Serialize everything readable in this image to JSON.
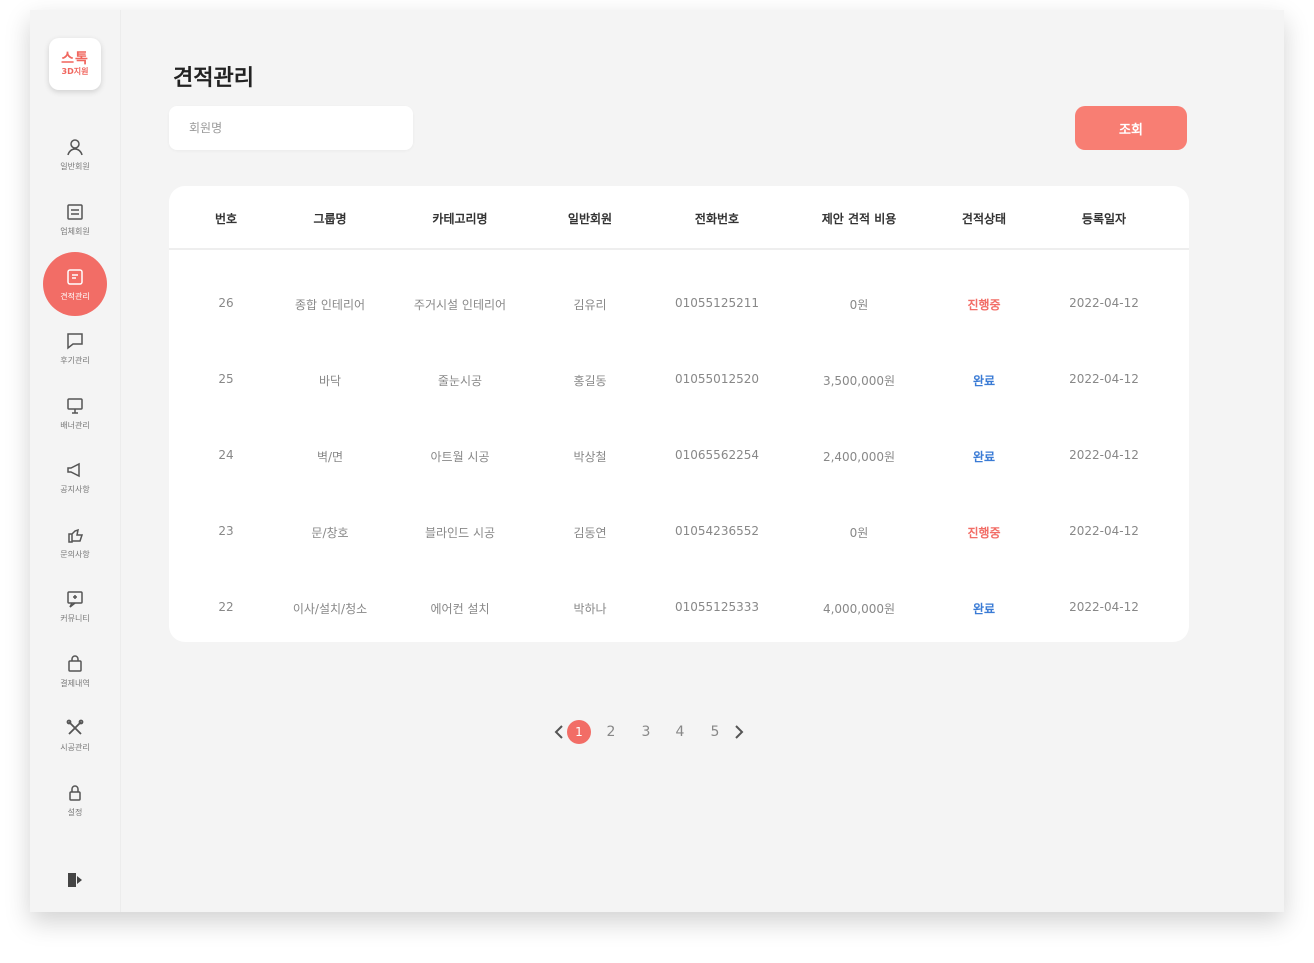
{
  "logo": {
    "line1": "스톡",
    "line2": "3D지원"
  },
  "sidebar": {
    "items": [
      {
        "label": "일반회원",
        "icon": "user-icon"
      },
      {
        "label": "업체회원",
        "icon": "company-icon"
      },
      {
        "label": "견적관리",
        "icon": "quote-icon",
        "active": true
      },
      {
        "label": "후기관리",
        "icon": "review-icon"
      },
      {
        "label": "배너관리",
        "icon": "banner-icon"
      },
      {
        "label": "공지사항",
        "icon": "notice-icon"
      },
      {
        "label": "문의사항",
        "icon": "inquiry-icon"
      },
      {
        "label": "커뮤니티",
        "icon": "community-icon"
      },
      {
        "label": "결제내역",
        "icon": "payment-icon"
      },
      {
        "label": "시공관리",
        "icon": "construction-icon"
      },
      {
        "label": "설정",
        "icon": "lock-icon"
      }
    ]
  },
  "page": {
    "title": "견적관리"
  },
  "search": {
    "placeholder": "회원명",
    "button_label": "조회"
  },
  "table": {
    "headers": [
      "번호",
      "그룹명",
      "카테고리명",
      "일반회원",
      "전화번호",
      "제안 견적 비용",
      "견적상태",
      "등록일자"
    ],
    "rows": [
      [
        "26",
        "종합 인테리어",
        "주거시설 인테리어",
        "김유리",
        "01055125211",
        "0원",
        "진행중",
        "2022-04-12"
      ],
      [
        "25",
        "바닥",
        "줄눈시공",
        "홍길동",
        "01055012520",
        "3,500,000원",
        "완료",
        "2022-04-12"
      ],
      [
        "24",
        "벽/면",
        "아트월 시공",
        "박상철",
        "01065562254",
        "2,400,000원",
        "완료",
        "2022-04-12"
      ],
      [
        "23",
        "문/창호",
        "블라인드 시공",
        "김동연",
        "01054236552",
        "0원",
        "진행중",
        "2022-04-12"
      ],
      [
        "22",
        "이사/설치/청소",
        "에어컨 설치",
        "박하나",
        "01055125333",
        "4,000,000원",
        "완료",
        "2022-04-12"
      ]
    ]
  },
  "pagination": {
    "pages": [
      "1",
      "2",
      "3",
      "4",
      "5"
    ],
    "current": "1"
  },
  "colors": {
    "accent": "#f26d66",
    "button": "#f87e73",
    "done": "#3a7bd5"
  }
}
